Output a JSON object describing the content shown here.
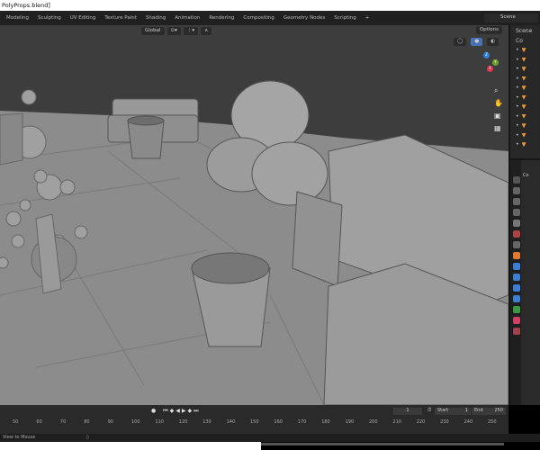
{
  "window": {
    "title": "PolyProps.blend]"
  },
  "workspace_tabs": [
    "Modeling",
    "Sculpting",
    "UV Editing",
    "Texture Paint",
    "Shading",
    "Animation",
    "Rendering",
    "Compositing",
    "Geometry Nodes",
    "Scripting",
    "+"
  ],
  "scene": {
    "label": "Scene"
  },
  "viewport": {
    "orientation": "Global",
    "options_label": "Options",
    "gizmo": {
      "z": "Z",
      "y": "Y",
      "x": "X"
    }
  },
  "outliner": {
    "root": "Scene",
    "collection": "Co"
  },
  "properties": {
    "object_label": "Co"
  },
  "timeline": {
    "current_frame": "1",
    "start_label": "Start",
    "start": "1",
    "end_label": "End",
    "end": "250",
    "ticks": [
      "50",
      "60",
      "70",
      "80",
      "90",
      "100",
      "110",
      "120",
      "130",
      "140",
      "150",
      "160",
      "170",
      "180",
      "190",
      "200",
      "210",
      "220",
      "230",
      "240",
      "250"
    ]
  },
  "status": {
    "hint": "View to Mouse"
  },
  "colors": {
    "accent": "#4772b3",
    "object": "#e89a3c",
    "floor": "#8c8c8c"
  }
}
